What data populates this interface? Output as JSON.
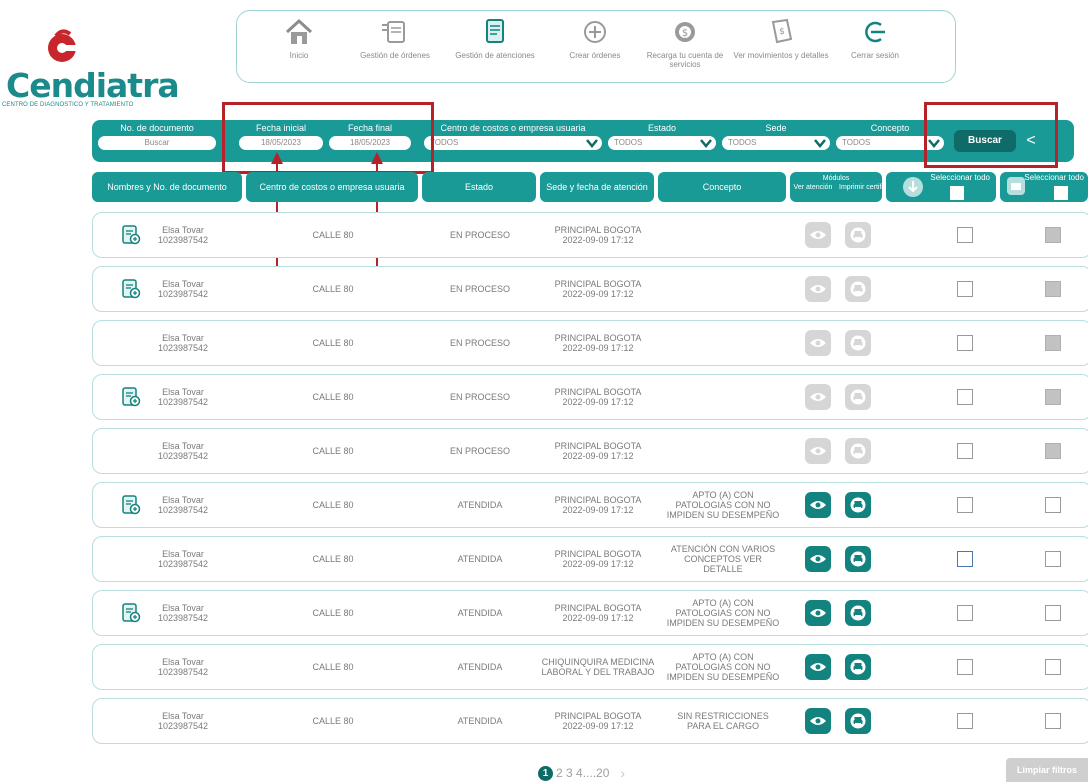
{
  "brand": {
    "name": "Cendiatra",
    "tagline": "CENTRO DE DIAGNOSTICO Y TRATAMIENTO",
    "color": "#1a8a8a",
    "accent": "#c8262c"
  },
  "nav": {
    "items": [
      {
        "label": "Inicio",
        "icon": "home-icon"
      },
      {
        "label": "Gestión de órdenes",
        "icon": "orders-icon"
      },
      {
        "label": "Gestión de atenciones",
        "icon": "document-edit-icon"
      },
      {
        "label": "Crear órdenes",
        "icon": "plus-circle-icon"
      },
      {
        "label": "Recarga tu cuenta de servicios",
        "icon": "coin-icon"
      },
      {
        "label": "Ver movimientos y detalles",
        "icon": "receipt-icon"
      },
      {
        "label": "Cerrar sesión",
        "icon": "logout-icon"
      }
    ]
  },
  "filters": {
    "documento": {
      "label": "No. de documento",
      "placeholder": "Buscar"
    },
    "fecha_inicial": {
      "label": "Fecha inicial",
      "value": "18/05/2023"
    },
    "fecha_final": {
      "label": "Fecha final",
      "value": "18/05/2023"
    },
    "centro": {
      "label": "Centro de costos o empresa usuaria",
      "value": "TODOS"
    },
    "estado": {
      "label": "Estado",
      "value": "TODOS"
    },
    "sede": {
      "label": "Sede",
      "value": "TODOS"
    },
    "concepto": {
      "label": "Concepto",
      "value": "TODOS"
    },
    "buscar_label": "Buscar",
    "collapse_glyph": "<"
  },
  "table": {
    "headers": {
      "nombre": "Nombres y No. de documento",
      "centro": "Centro de costos o empresa usuaria",
      "estado": "Estado",
      "sede": "Sede y fecha de atención",
      "concepto": "Concepto",
      "modulos": "Módulos",
      "ver": "Ver atención",
      "imprimir": "Imprimir certificado",
      "seleccionar1": "Seleccionar todo",
      "seleccionar2": "Seleccionar todo"
    },
    "rows": [
      {
        "nombre": "Elsa Tovar",
        "documento": "1023987542",
        "has_icon": true,
        "centro": "CALLE 80",
        "estado": "EN PROCESO",
        "sede": "PRINCIPAL BOGOTA",
        "fecha": "2022-09-09 17:12",
        "concepto": "",
        "enabled": false
      },
      {
        "nombre": "Elsa Tovar",
        "documento": "1023987542",
        "has_icon": true,
        "centro": "CALLE 80",
        "estado": "EN PROCESO",
        "sede": "PRINCIPAL BOGOTA",
        "fecha": "2022-09-09 17:12",
        "concepto": "",
        "enabled": false
      },
      {
        "nombre": "Elsa Tovar",
        "documento": "1023987542",
        "has_icon": false,
        "centro": "CALLE 80",
        "estado": "EN PROCESO",
        "sede": "PRINCIPAL BOGOTA",
        "fecha": "2022-09-09 17:12",
        "concepto": "",
        "enabled": false
      },
      {
        "nombre": "Elsa Tovar",
        "documento": "1023987542",
        "has_icon": true,
        "centro": "CALLE 80",
        "estado": "EN PROCESO",
        "sede": "PRINCIPAL BOGOTA",
        "fecha": "2022-09-09 17:12",
        "concepto": "",
        "enabled": false
      },
      {
        "nombre": "Elsa Tovar",
        "documento": "1023987542",
        "has_icon": false,
        "centro": "CALLE 80",
        "estado": "EN PROCESO",
        "sede": "PRINCIPAL BOGOTA",
        "fecha": "2022-09-09 17:12",
        "concepto": "",
        "enabled": false
      },
      {
        "nombre": "Elsa Tovar",
        "documento": "1023987542",
        "has_icon": true,
        "centro": "CALLE 80",
        "estado": "ATENDIDA",
        "sede": "PRINCIPAL BOGOTA",
        "fecha": "2022-09-09 17:12",
        "concepto": "APTO (A) CON PATOLOGIAS CON NO IMPIDEN SU DESEMPEÑO",
        "enabled": true
      },
      {
        "nombre": "Elsa Tovar",
        "documento": "1023987542",
        "has_icon": false,
        "centro": "CALLE 80",
        "estado": "ATENDIDA",
        "sede": "PRINCIPAL BOGOTA",
        "fecha": "2022-09-09 17:12",
        "concepto": "ATENCIÓN CON VARIOS CONCEPTOS VER DETALLE",
        "enabled": true,
        "highlight_check": true
      },
      {
        "nombre": "Elsa Tovar",
        "documento": "1023987542",
        "has_icon": true,
        "centro": "CALLE 80",
        "estado": "ATENDIDA",
        "sede": "PRINCIPAL BOGOTA",
        "fecha": "2022-09-09 17:12",
        "concepto": "APTO (A) CON PATOLOGIAS CON NO IMPIDEN SU DESEMPEÑO",
        "enabled": true
      },
      {
        "nombre": "Elsa Tovar",
        "documento": "1023987542",
        "has_icon": false,
        "centro": "CALLE 80",
        "estado": "ATENDIDA",
        "sede": "CHIQUINQUIRA MEDICINA LABORAL Y DEL TRABAJO",
        "fecha": "",
        "concepto": "APTO (A) CON PATOLOGIAS CON NO IMPIDEN SU DESEMPEÑO",
        "enabled": true
      },
      {
        "nombre": "Elsa Tovar",
        "documento": "1023987542",
        "has_icon": false,
        "centro": "CALLE 80",
        "estado": "ATENDIDA",
        "sede": "PRINCIPAL BOGOTA",
        "fecha": "2022-09-09 17:12",
        "concepto": "SIN RESTRICCIONES PARA EL CARGO",
        "enabled": true
      }
    ]
  },
  "pagination": {
    "current": "1",
    "others": "2 3 4....20",
    "next": "›"
  },
  "clear_filters_label": "Limpiar filtros"
}
